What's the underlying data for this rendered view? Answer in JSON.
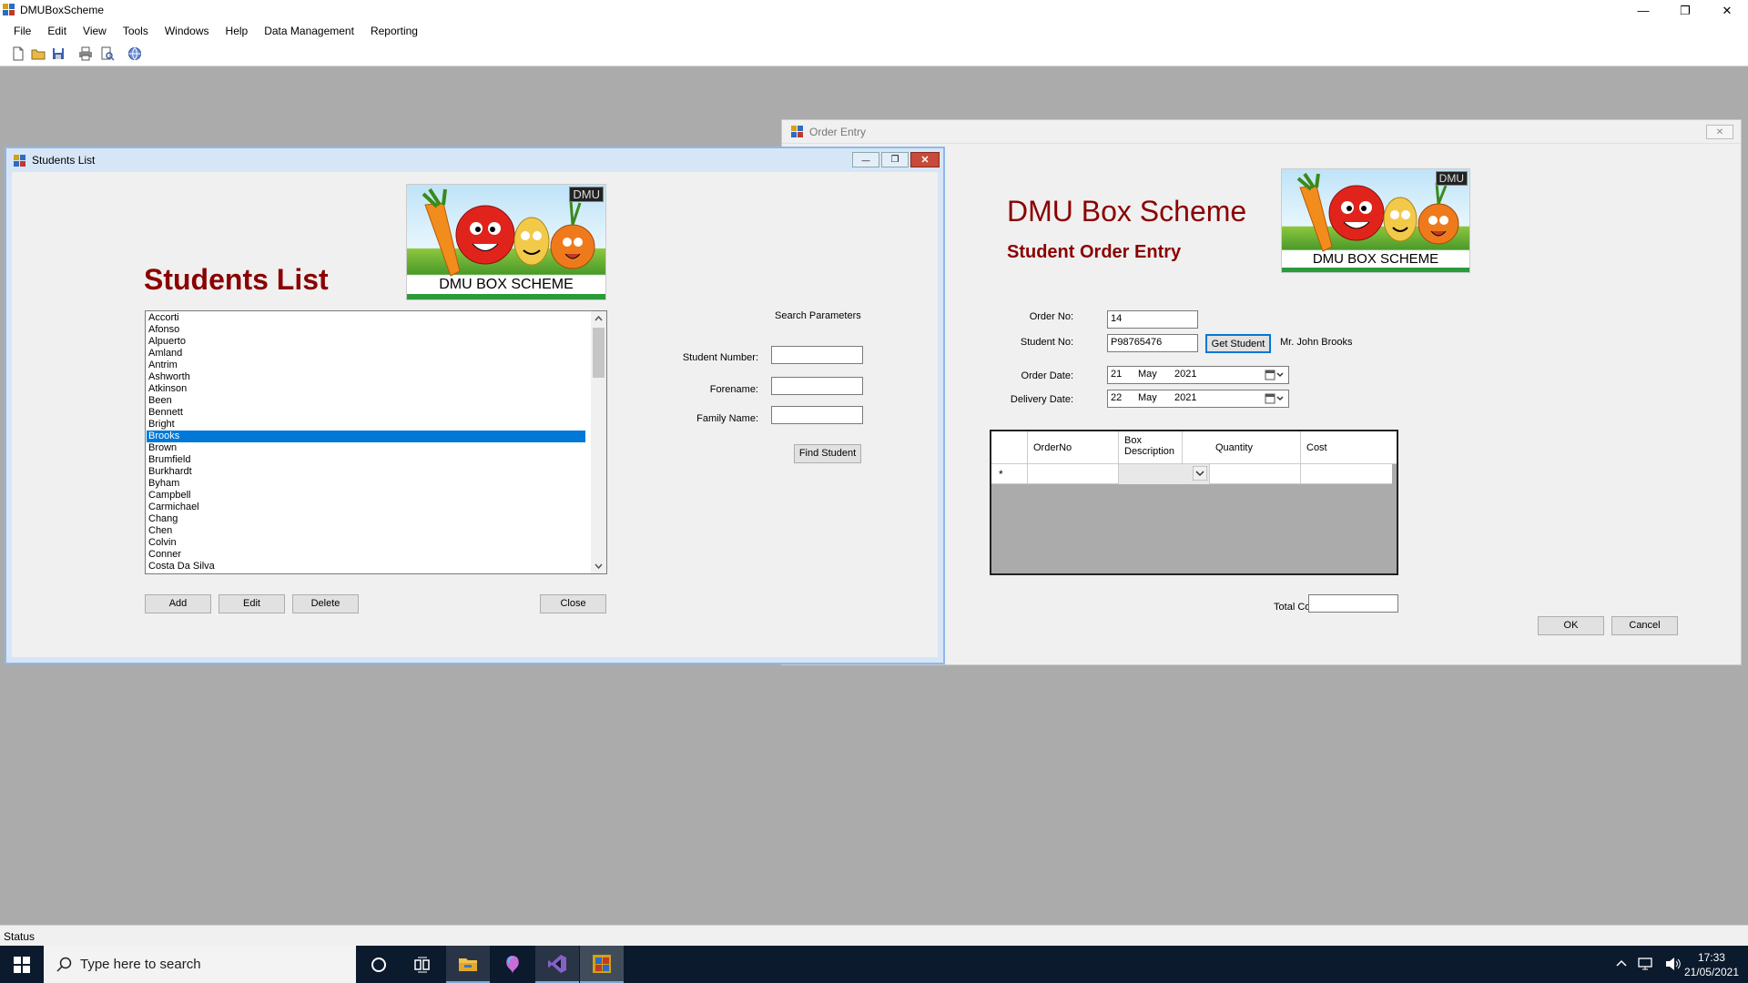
{
  "app": {
    "title": "DMUBoxScheme",
    "minimize_glyph": "—",
    "restore_glyph": "❐",
    "close_glyph": "✕"
  },
  "menu": [
    "File",
    "Edit",
    "View",
    "Tools",
    "Windows",
    "Help",
    "Data Management",
    "Reporting"
  ],
  "status": {
    "text": "Status"
  },
  "students_window": {
    "title": "Students List",
    "heading": "Students List",
    "logo_text": "DMU BOX SCHEME",
    "logo_badge": "DMU",
    "students": [
      "Accorti",
      "Afonso",
      "Alpuerto",
      "Amland",
      "Antrim",
      "Ashworth",
      "Atkinson",
      "Been",
      "Bennett",
      "Bright",
      "Brooks",
      "Brown",
      "Brumfield",
      "Burkhardt",
      "Byham",
      "Campbell",
      "Carmichael",
      "Chang",
      "Chen",
      "Colvin",
      "Conner",
      "Costa Da Silva"
    ],
    "selected_student": "Brooks",
    "search_heading": "Search Parameters",
    "labels": {
      "student_number": "Student Number:",
      "forename": "Forename:",
      "family_name": "Family Name:"
    },
    "values": {
      "student_number": "",
      "forename": "",
      "family_name": ""
    },
    "buttons": {
      "find": "Find Student",
      "add": "Add",
      "edit": "Edit",
      "delete": "Delete",
      "close": "Close"
    }
  },
  "order_window": {
    "title": "Order Entry",
    "heading": "DMU Box Scheme",
    "subheading": "Student Order Entry",
    "logo_text": "DMU BOX SCHEME",
    "logo_badge": "DMU",
    "labels": {
      "order_no": "Order No:",
      "student_no": "Student No:",
      "order_date": "Order Date:",
      "delivery_date": "Delivery Date:",
      "total_cost": "Total Cost:"
    },
    "values": {
      "order_no": "14",
      "student_no": "P98765476",
      "student_name": "Mr. John Brooks",
      "total_cost": ""
    },
    "order_date": {
      "day": "21",
      "month": "May",
      "year": "2021"
    },
    "delivery_date": {
      "day": "22",
      "month": "May",
      "year": "2021"
    },
    "grid": {
      "columns": [
        "OrderNo",
        "Box Description",
        "Quantity",
        "Cost"
      ],
      "new_row_marker": "*"
    },
    "buttons": {
      "get_student": "Get Student",
      "ok": "OK",
      "cancel": "Cancel"
    }
  },
  "taskbar": {
    "search_placeholder": "Type here to search",
    "time": "17:33",
    "date": "21/05/2021"
  },
  "colors": {
    "accent": "#0078d7",
    "heading": "#8b0000",
    "mdi_background": "#ababab",
    "taskbar": "#0c1a2d"
  }
}
